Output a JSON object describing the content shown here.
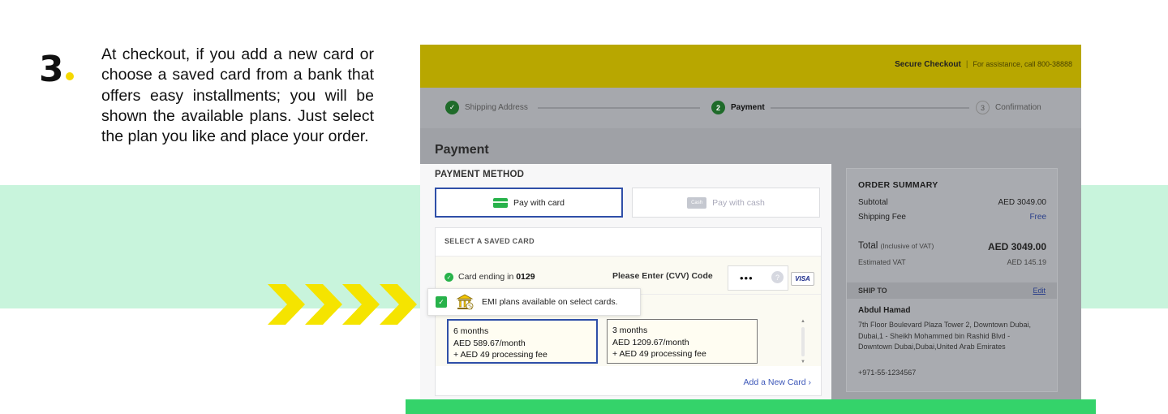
{
  "step": {
    "number": "3",
    "text": "At checkout, if you add a new card or choose a saved card from a bank that offers easy installments; you will be shown the available plans. Just select the plan you like and place your order."
  },
  "header": {
    "title": "Secure Checkout",
    "separator": "|",
    "assistance": "For assistance, call 800-38888"
  },
  "progress": {
    "steps": [
      {
        "number": "✓",
        "label": "Shipping Address"
      },
      {
        "number": "2",
        "label": "Payment"
      },
      {
        "number": "3",
        "label": "Confirmation"
      }
    ]
  },
  "page_title": "Payment",
  "payment_method": {
    "title": "PAYMENT METHOD",
    "card_label": "Pay with card",
    "cash_icon": "Cash",
    "cash_label": "Pay with cash"
  },
  "saved_card": {
    "title": "SELECT A SAVED CARD",
    "card_prefix": "Card ending in",
    "card_last4": "0129",
    "cvv_label": "Please Enter (CVV) Code",
    "cvv_value": "•••",
    "help": "?",
    "brand": "VISA"
  },
  "emi": {
    "message": "EMI plans available on select cards."
  },
  "plans": [
    {
      "duration": "6 months",
      "amount": "AED 589.67/month",
      "fee": "+ AED 49 processing fee"
    },
    {
      "duration": "3 months",
      "amount": "AED 1209.67/month",
      "fee": "+ AED 49 processing fee"
    }
  ],
  "add_card": "Add a New Card ›",
  "order_summary": {
    "title": "ORDER SUMMARY",
    "subtotal_label": "Subtotal",
    "subtotal_value": "AED 3049.00",
    "shipping_label": "Shipping Fee",
    "shipping_value": "Free",
    "total_label": "Total",
    "total_note": "(Inclusive of VAT)",
    "total_value": "AED 3049.00",
    "vat_label": "Estimated VAT",
    "vat_value": "AED 145.19"
  },
  "ship_to": {
    "title": "SHIP TO",
    "edit": "Edit",
    "name": "Abdul Hamad",
    "address": "7th Floor Boulevard Plaza Tower 2, Downtown Dubai, Dubai,1 - Sheikh Mohammed bin Rashid Blvd - Downtown Dubai,Dubai,United Arab Emirates",
    "phone": "+971-55-1234567"
  },
  "colors": {
    "mint": "#c8f4dc",
    "green": "#34d36a",
    "chevron": "#f5e400",
    "accent": "#2f4fa8"
  }
}
